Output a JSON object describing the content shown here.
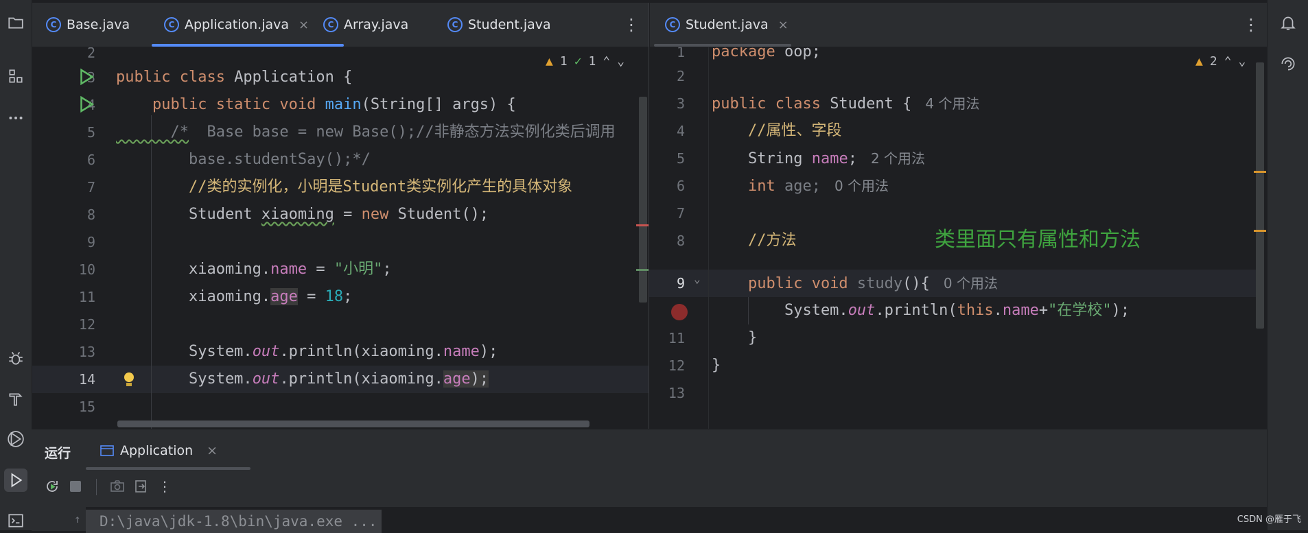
{
  "colors": {
    "accent": "#548af7",
    "run_green": "#5fb865",
    "keyword": "#cf8e6d",
    "field": "#c77dbb",
    "string": "#6aab73",
    "number": "#2aacb8",
    "todo_comment": "#d5b778",
    "annotation_green": "#3fa43f",
    "breakpoint": "#8c2c2c"
  },
  "left_editor": {
    "tabs": [
      {
        "label": "Base.java",
        "icon": "class-icon"
      },
      {
        "label": "Application.java",
        "icon": "class-run-icon",
        "active": true,
        "close": "×"
      },
      {
        "label": "Array.java",
        "icon": "class-run-icon"
      },
      {
        "label": "Student.java",
        "icon": "class-icon"
      }
    ],
    "inspections": {
      "warnings": "1",
      "weak_warnings": "1"
    },
    "line_numbers": [
      "2",
      "3",
      "4",
      "5",
      "6",
      "7",
      "8",
      "9",
      "10",
      "11",
      "12",
      "13",
      "14",
      "15"
    ],
    "code": {
      "l3_a": "public class ",
      "l3_b": "Application {",
      "l4_a": "    public static void ",
      "l4_b": "main",
      "l4_c": "(String[] args) {",
      "l5_a": "      /*",
      "l5_b": "  Base base = new Base();//非静态方法实例化类后调用",
      "l6": "        base.studentSay();*/",
      "l7": "        //类的实例化，小明是Student类实例化产生的具体对象",
      "l8_a": "        Student ",
      "l8_b": "xiaoming",
      "l8_c": " = ",
      "l8_d": "new",
      "l8_e": " Student();",
      "l10_a": "        xiaoming.",
      "l10_b": "name",
      "l10_c": " = ",
      "l10_d": "\"小明\"",
      "l10_e": ";",
      "l11_a": "        xiaoming.",
      "l11_b": "age",
      "l11_c": " = ",
      "l11_d": "18",
      "l11_e": ";",
      "l13_a": "        System.",
      "l13_b": "out",
      "l13_c": ".println(xiaoming.",
      "l13_d": "name",
      "l13_e": ");",
      "l14_a": "        System.",
      "l14_b": "out",
      "l14_c": ".println(",
      "l14_d": "xiaoming.",
      "l14_e": "age",
      "l14_f": ");"
    }
  },
  "right_editor": {
    "tab": {
      "label": "Student.java",
      "close": "×"
    },
    "inspections": {
      "warnings": "2"
    },
    "line_numbers": [
      "1",
      "2",
      "3",
      "4",
      "5",
      "6",
      "7",
      "8",
      "9",
      "",
      "11",
      "12",
      "13"
    ],
    "code": {
      "l1_a": "package",
      "l1_b": " oop;",
      "l3_a": "public class ",
      "l3_b": "Student {",
      "l3_hint": "4 个用法",
      "l4": "    //属性、字段",
      "l5_a": "    String ",
      "l5_b": "name",
      "l5_c": ";",
      "l5_hint": "2 个用法",
      "l6_a": "    int",
      "l6_b": " age;",
      "l6_hint": "0 个用法",
      "l8": "    //方法",
      "l9_a": "    public void ",
      "l9_b": "study",
      "l9_c": "(){",
      "l9_hint": "0 个用法",
      "l10_a": "        System.",
      "l10_b": "out",
      "l10_c": ".println(",
      "l10_d": "this",
      "l10_e": ".",
      "l10_f": "name",
      "l10_g": "+",
      "l10_h": "\"在学校\"",
      "l10_i": ");",
      "l11": "    }",
      "l12": "}"
    },
    "annotation": "类里面只有属性和方法"
  },
  "bottom_panel": {
    "title": "运行",
    "run_tab": "Application",
    "run_tab_close": "×",
    "console_line": "D:\\java\\jdk-1.8\\bin\\java.exe ..."
  },
  "watermark": "CSDN @雁于飞"
}
